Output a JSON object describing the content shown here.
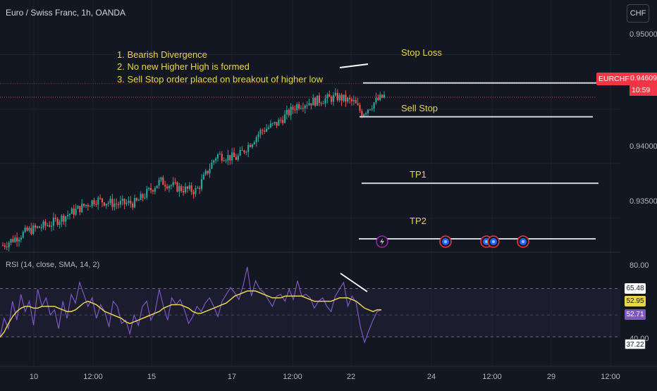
{
  "header": {
    "title": "Euro / Swiss Franc, 1h, OANDA",
    "currency_button": "CHF"
  },
  "annotations": {
    "notes": [
      "1. Bearish Divergence",
      "2. No new Higher High is formed",
      "3. Sell Stop order placed on breakout of higher low"
    ],
    "stop_loss_label": "Stop Loss",
    "sell_stop_label": "Sell Stop",
    "tp1_label": "TP1",
    "tp2_label": "TP2"
  },
  "levels": {
    "stop_loss": 0.9474,
    "sell_stop": 0.9443,
    "tp1": 0.9382,
    "tp2": 0.9331
  },
  "price_tag": {
    "symbol": "EURCHF",
    "price": "0.94609",
    "countdown": "10:59"
  },
  "price_axis": {
    "ticks": [
      "0.95000",
      "0.94000",
      "0.93500"
    ]
  },
  "rsi": {
    "title": "RSI (14, close, SMA, 14, 2)",
    "axis_ticks": [
      "80.00",
      "40.00"
    ],
    "upper_tag": "65.48",
    "sma_tag": "52.95",
    "rsi_tag": "52.71",
    "lower_tag": "37.22",
    "colors": {
      "rsi": "#7e57c2",
      "sma": "#e8d44d"
    }
  },
  "time_axis": {
    "labels": [
      "10",
      "12:00",
      "15",
      "17",
      "12:00",
      "22",
      "24",
      "12:00",
      "29",
      "12:00"
    ]
  },
  "event_icons": [
    "lightning-icon",
    "earnings-icon",
    "earnings-icon",
    "earnings-icon",
    "earnings-icon"
  ],
  "colors": {
    "background": "#131722",
    "up": "#26a69a",
    "down": "#ef5350",
    "annotation": "#e8d44d",
    "level_line": "#d1d4dc",
    "accent_red": "#f23645"
  },
  "chart_data": [
    {
      "type": "candlestick",
      "title": "Euro / Swiss Franc, 1h, OANDA",
      "x_labels": [
        "10",
        "12:00",
        "15",
        "17",
        "12:00",
        "22",
        "24",
        "12:00",
        "29",
        "12:00"
      ],
      "ylim": [
        0.932,
        0.9532
      ],
      "trend_path_price": [
        [
          0,
          0.9325
        ],
        [
          12,
          0.9338
        ],
        [
          24,
          0.9345
        ],
        [
          34,
          0.9355
        ],
        [
          46,
          0.9367
        ],
        [
          56,
          0.9363
        ],
        [
          66,
          0.9364
        ],
        [
          78,
          0.9384
        ],
        [
          88,
          0.9377
        ],
        [
          96,
          0.9375
        ],
        [
          106,
          0.9408
        ],
        [
          116,
          0.9405
        ],
        [
          128,
          0.943
        ],
        [
          136,
          0.9437
        ],
        [
          146,
          0.9454
        ],
        [
          156,
          0.9458
        ],
        [
          166,
          0.9461
        ],
        [
          174,
          0.9456
        ],
        [
          178,
          0.9446
        ],
        [
          184,
          0.9456
        ],
        [
          189,
          0.9462
        ]
      ],
      "last_price": 0.94609
    },
    {
      "type": "line",
      "title": "RSI (14, close, SMA, 14, 2)",
      "ylim": [
        20,
        85
      ],
      "levels": [
        65.48,
        37.22
      ],
      "series": [
        {
          "name": "RSI",
          "values": [
            37,
            48,
            42,
            58,
            47,
            62,
            52,
            58,
            44,
            65,
            55,
            60,
            50,
            53,
            42,
            58,
            48,
            62,
            57,
            69,
            62,
            55,
            60,
            48,
            56,
            52,
            43,
            58,
            55,
            45,
            47,
            39,
            50,
            44,
            55,
            58,
            47,
            52,
            65,
            55,
            47,
            60,
            56,
            59,
            53,
            45,
            49,
            55,
            52,
            57,
            60,
            55,
            49,
            58,
            62,
            66,
            63,
            59,
            67,
            78,
            61,
            70,
            65,
            63,
            59,
            55,
            61,
            62,
            58,
            65,
            59,
            70,
            61,
            62,
            60,
            54,
            58,
            60,
            55,
            52,
            61,
            65,
            69,
            55,
            61,
            57,
            43,
            34,
            41,
            47,
            52,
            53
          ]
        },
        {
          "name": "SMA",
          "values": [
            37,
            40,
            45,
            49,
            52,
            54,
            55,
            55,
            54,
            54,
            55,
            55,
            55,
            55,
            54,
            53,
            52,
            52,
            53,
            55,
            57,
            58,
            57,
            56,
            54,
            52,
            51,
            50,
            49,
            48,
            46,
            45,
            46,
            47,
            48,
            49,
            50,
            51,
            52,
            54,
            55,
            56,
            56,
            56,
            55,
            54,
            52,
            51,
            51,
            52,
            53,
            54,
            55,
            56,
            57,
            59,
            61,
            62,
            63,
            64,
            64,
            64,
            63,
            62,
            61,
            60,
            60,
            60,
            61,
            61,
            61,
            61,
            61,
            60,
            59,
            58,
            58,
            58,
            58,
            58,
            59,
            60,
            60,
            60,
            59,
            58,
            56,
            54,
            53,
            52,
            53,
            53
          ]
        }
      ]
    }
  ]
}
